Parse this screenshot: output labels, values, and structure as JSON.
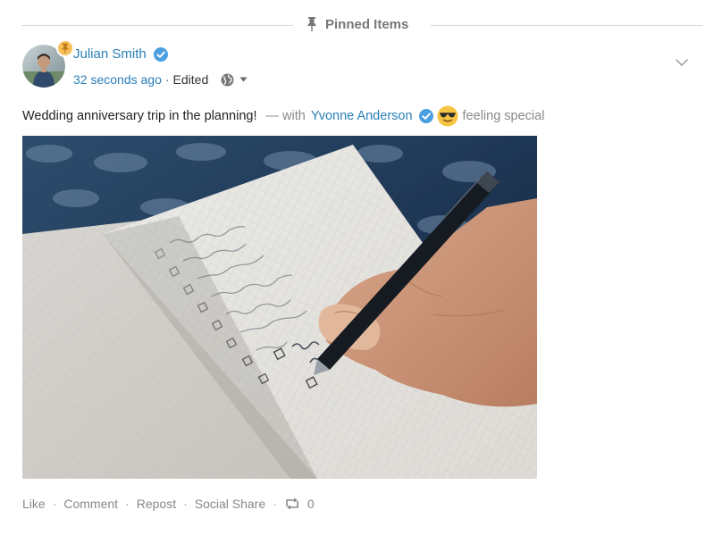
{
  "pinned": {
    "label": "Pinned Items"
  },
  "post": {
    "author": {
      "name": "Julian Smith"
    },
    "timestamp": "32 seconds ago",
    "edited": "Edited",
    "caption": "Wedding anniversary trip in the planning!",
    "with_prefix": "— with",
    "tagged_name": "Yvonne Anderson",
    "feeling": "feeling special",
    "icons": {
      "pin": "pin-icon",
      "verified": "verified-check-icon",
      "privacy": "globe-icon",
      "options": "chevron-down-icon",
      "feeling": "sunglasses-emoji",
      "repost": "repost-icon"
    }
  },
  "actions": {
    "like": "Like",
    "comment": "Comment",
    "repost": "Repost",
    "social_share": "Social Share",
    "repost_count": "0",
    "separator": "·"
  },
  "colors": {
    "link": "#2a7fb8",
    "muted": "#888888",
    "verified": "#4a9fe0",
    "pin_badge": "#f7c05a",
    "divider": "#d9d9d9"
  }
}
